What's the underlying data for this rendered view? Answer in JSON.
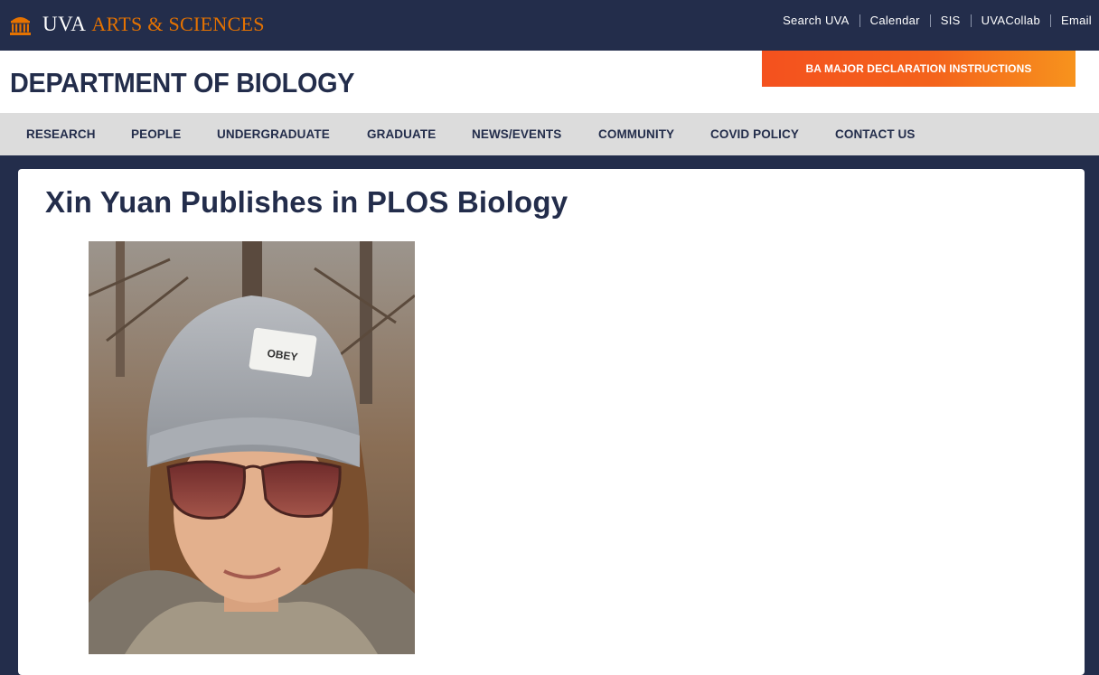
{
  "brand": {
    "uva": "UVA",
    "arts_sciences": "ARTS & SCIENCES",
    "orange": "#e57200",
    "navy": "#232d4b"
  },
  "utility_links": [
    "Search UVA",
    "Calendar",
    "SIS",
    "UVACollab",
    "Email"
  ],
  "header": {
    "department": "DEPARTMENT OF BIOLOGY",
    "cta_label": "BA MAJOR DECLARATION INSTRUCTIONS"
  },
  "nav": {
    "items": [
      "RESEARCH",
      "PEOPLE",
      "UNDERGRADUATE",
      "GRADUATE",
      "NEWS/EVENTS",
      "COMMUNITY",
      "COVID POLICY",
      "CONTACT US"
    ]
  },
  "article": {
    "title": "Xin Yuan Publishes in PLOS Biology",
    "photo_hat_label": "OBEY",
    "photo_icon": "portrait-photo"
  }
}
